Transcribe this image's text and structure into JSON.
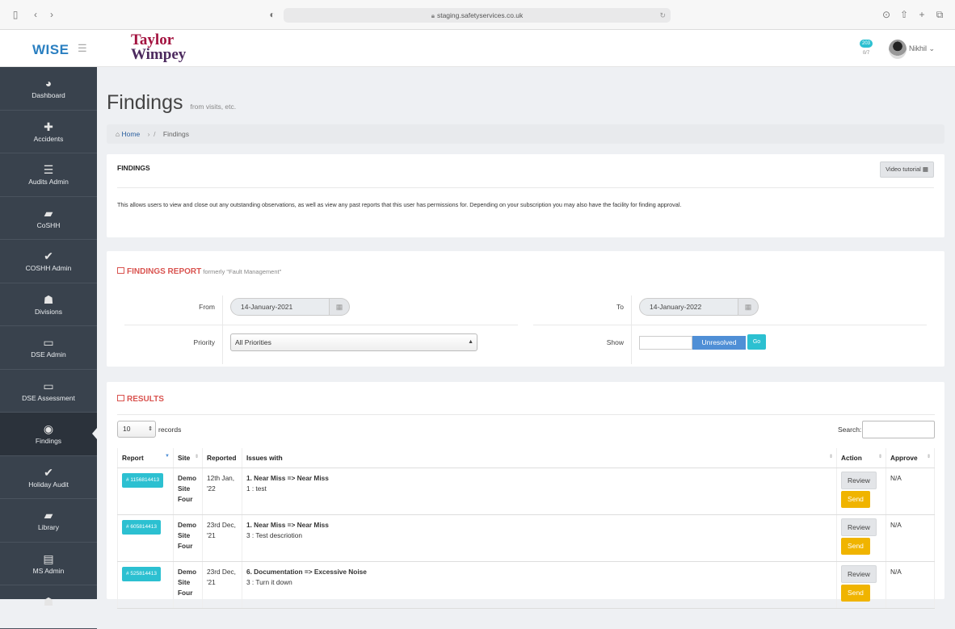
{
  "browser": {
    "url": "staging.safetyservices.co.uk"
  },
  "app": {
    "logo": "WISE",
    "brand_line1": "Taylor",
    "brand_line2": "Wimpey"
  },
  "header": {
    "notification_count": "203",
    "notification_sub": "0/7",
    "user_name": "Nikhil"
  },
  "sidebar": {
    "items": [
      {
        "label": "Dashboard",
        "icon": "dashboard-icon",
        "glyph": "◕"
      },
      {
        "label": "Accidents",
        "icon": "medkit-icon",
        "glyph": "✚"
      },
      {
        "label": "Audits Admin",
        "icon": "list-icon",
        "glyph": "☰"
      },
      {
        "label": "CoSHH",
        "icon": "book-icon",
        "glyph": "▰"
      },
      {
        "label": "COSHH Admin",
        "icon": "check-icon",
        "glyph": "✔"
      },
      {
        "label": "Divisions",
        "icon": "users-icon",
        "glyph": "☗"
      },
      {
        "label": "DSE Admin",
        "icon": "monitor-icon",
        "glyph": "▭"
      },
      {
        "label": "DSE Assessment",
        "icon": "monitor-icon",
        "glyph": "▭"
      },
      {
        "label": "Findings",
        "icon": "eye-icon",
        "glyph": "◉"
      },
      {
        "label": "Holiday Audit",
        "icon": "check-icon",
        "glyph": "✔"
      },
      {
        "label": "Library",
        "icon": "book-icon",
        "glyph": "▰"
      },
      {
        "label": "MS Admin",
        "icon": "list-alt-icon",
        "glyph": "▤"
      },
      {
        "label": "",
        "icon": "users-icon",
        "glyph": "☗"
      }
    ],
    "active_index": 8
  },
  "page": {
    "title": "Findings",
    "subtitle": "from visits, etc.",
    "breadcrumb_home": "Home",
    "breadcrumb_current": "Findings"
  },
  "info_panel": {
    "title": "FINDINGS",
    "video_button": "Video tutorial",
    "description": "This allows users to view and close out any outstanding observations, as well as view any past reports that this user has permissions for. Depending on your subscription you may also have the facility for finding approval."
  },
  "report_panel": {
    "title": "FINDINGS REPORT",
    "subtitle": "formerly \"Fault Management\"",
    "from_label": "From",
    "from_value": "14-January-2021",
    "to_label": "To",
    "to_value": "14-January-2022",
    "priority_label": "Priority",
    "priority_value": "All Priorities",
    "show_label": "Show",
    "show_value": "Unresolved",
    "go_button": "Go"
  },
  "results": {
    "title": "RESULTS",
    "page_length": "10",
    "records_label": "records",
    "search_label": "Search:",
    "columns": [
      "Report",
      "Site",
      "Reported",
      "Issues with",
      "Action",
      "Approve"
    ],
    "rows": [
      {
        "report": "# 1156814413",
        "site": "Demo Site Four",
        "reported": "12th Jan, '22",
        "issue_title": "1. Near Miss => Near Miss",
        "issue_detail": "1 : test",
        "review": "Review",
        "send": "Send",
        "approve": "N/A"
      },
      {
        "report": "# 605814413",
        "site": "Demo Site Four",
        "reported": "23rd Dec, '21",
        "issue_title": "1. Near Miss => Near Miss",
        "issue_detail": "3 : Test descriotion",
        "review": "Review",
        "send": "Send",
        "approve": "N/A"
      },
      {
        "report": "# 525814413",
        "site": "Demo Site Four",
        "reported": "23rd Dec, '21",
        "issue_title": "6. Documentation => Excessive Noise",
        "issue_detail": "3 : Turn it down",
        "review": "Review",
        "send": "Send",
        "approve": "N/A"
      }
    ]
  },
  "colors": {
    "sidebar_bg": "#39424d",
    "accent_teal": "#2cc0d1",
    "section_red": "#d9534f",
    "send_yellow": "#f0b400",
    "unresolved_blue": "#4f8fd6"
  }
}
